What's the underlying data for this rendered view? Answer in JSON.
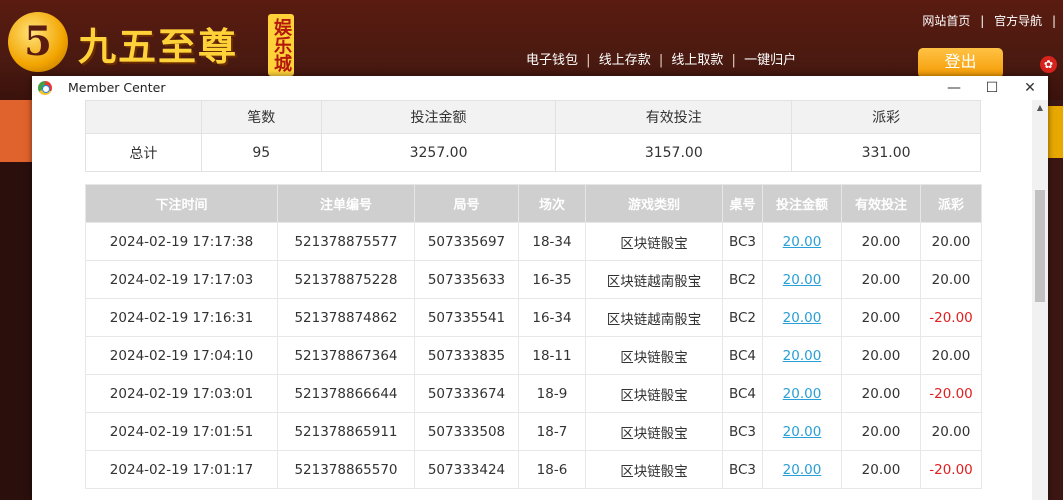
{
  "site": {
    "logo_mark": "5",
    "name": "九五至尊",
    "badge": "娱乐城",
    "top_links": [
      "网站首页",
      "|",
      "官方导航",
      "|"
    ],
    "wallet_nav": [
      "电子钱包",
      "|",
      "线上存款",
      "|",
      "线上取款",
      "|",
      "一键归户"
    ],
    "logout_label": "登出",
    "accent": "#f49a00"
  },
  "window": {
    "title": "Member Center",
    "min_glyph": "—",
    "max_glyph": "☐",
    "close_glyph": "✕"
  },
  "summary": {
    "headers": [
      "",
      "笔数",
      "投注金额",
      "有效投注",
      "派彩"
    ],
    "row": [
      "总计",
      "95",
      "3257.00",
      "3157.00",
      "331.00"
    ]
  },
  "detail": {
    "headers": [
      "下注时间",
      "注单编号",
      "局号",
      "场次",
      "游戏类别",
      "桌号",
      "投注金额",
      "有效投注",
      "派彩"
    ],
    "rows": [
      [
        "2024-02-19 17:17:38",
        "521378875577",
        "507335697",
        "18-34",
        "区块链骰宝",
        "BC3",
        "20.00",
        "20.00",
        "20.00"
      ],
      [
        "2024-02-19 17:17:03",
        "521378875228",
        "507335633",
        "16-35",
        "区块链越南骰宝",
        "BC2",
        "20.00",
        "20.00",
        "20.00"
      ],
      [
        "2024-02-19 17:16:31",
        "521378874862",
        "507335541",
        "16-34",
        "区块链越南骰宝",
        "BC2",
        "20.00",
        "20.00",
        "-20.00"
      ],
      [
        "2024-02-19 17:04:10",
        "521378867364",
        "507333835",
        "18-11",
        "区块链骰宝",
        "BC4",
        "20.00",
        "20.00",
        "20.00"
      ],
      [
        "2024-02-19 17:03:01",
        "521378866644",
        "507333674",
        "18-9",
        "区块链骰宝",
        "BC4",
        "20.00",
        "20.00",
        "-20.00"
      ],
      [
        "2024-02-19 17:01:51",
        "521378865911",
        "507333508",
        "18-7",
        "区块链骰宝",
        "BC3",
        "20.00",
        "20.00",
        "20.00"
      ],
      [
        "2024-02-19 17:01:17",
        "521378865570",
        "507333424",
        "18-6",
        "区块链骰宝",
        "BC3",
        "20.00",
        "20.00",
        "-20.00"
      ]
    ],
    "link_color": "#2a9fd6",
    "negative_color": "#e02020"
  }
}
